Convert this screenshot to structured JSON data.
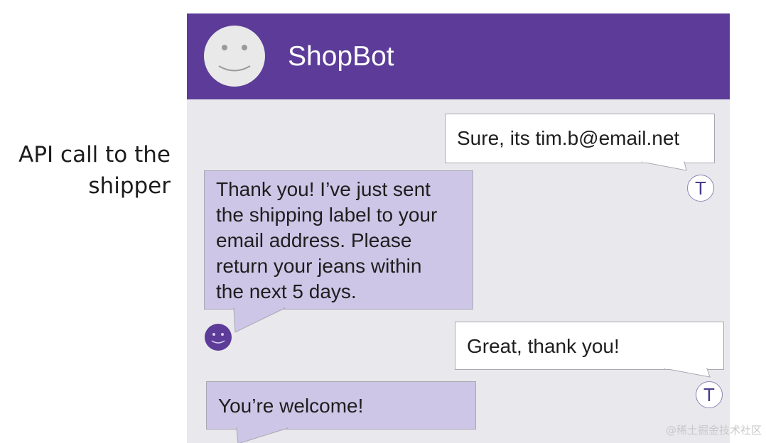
{
  "annotation": {
    "line1": "API call to the",
    "line2": "shipper"
  },
  "chat": {
    "title": "ShopBot",
    "bot_avatar_icon": "smiley-face-icon",
    "user_avatar_initial": "T",
    "messages": [
      {
        "sender": "user",
        "text": "Sure, its tim.b@email.net"
      },
      {
        "sender": "bot",
        "lines": [
          "Thank you! I’ve just sent",
          "the shipping label to your",
          "email address. Please",
          "return your jeans within",
          "the next 5 days."
        ]
      },
      {
        "sender": "user",
        "text": "Great, thank you!"
      },
      {
        "sender": "bot",
        "text": "You’re welcome!"
      }
    ]
  },
  "colors": {
    "header": "#5c3c98",
    "bot_bubble": "#cdc6e6",
    "user_bubble": "#ffffff",
    "chat_background": "#e9e8ec"
  },
  "watermark": "@稀土掘金技术社区"
}
